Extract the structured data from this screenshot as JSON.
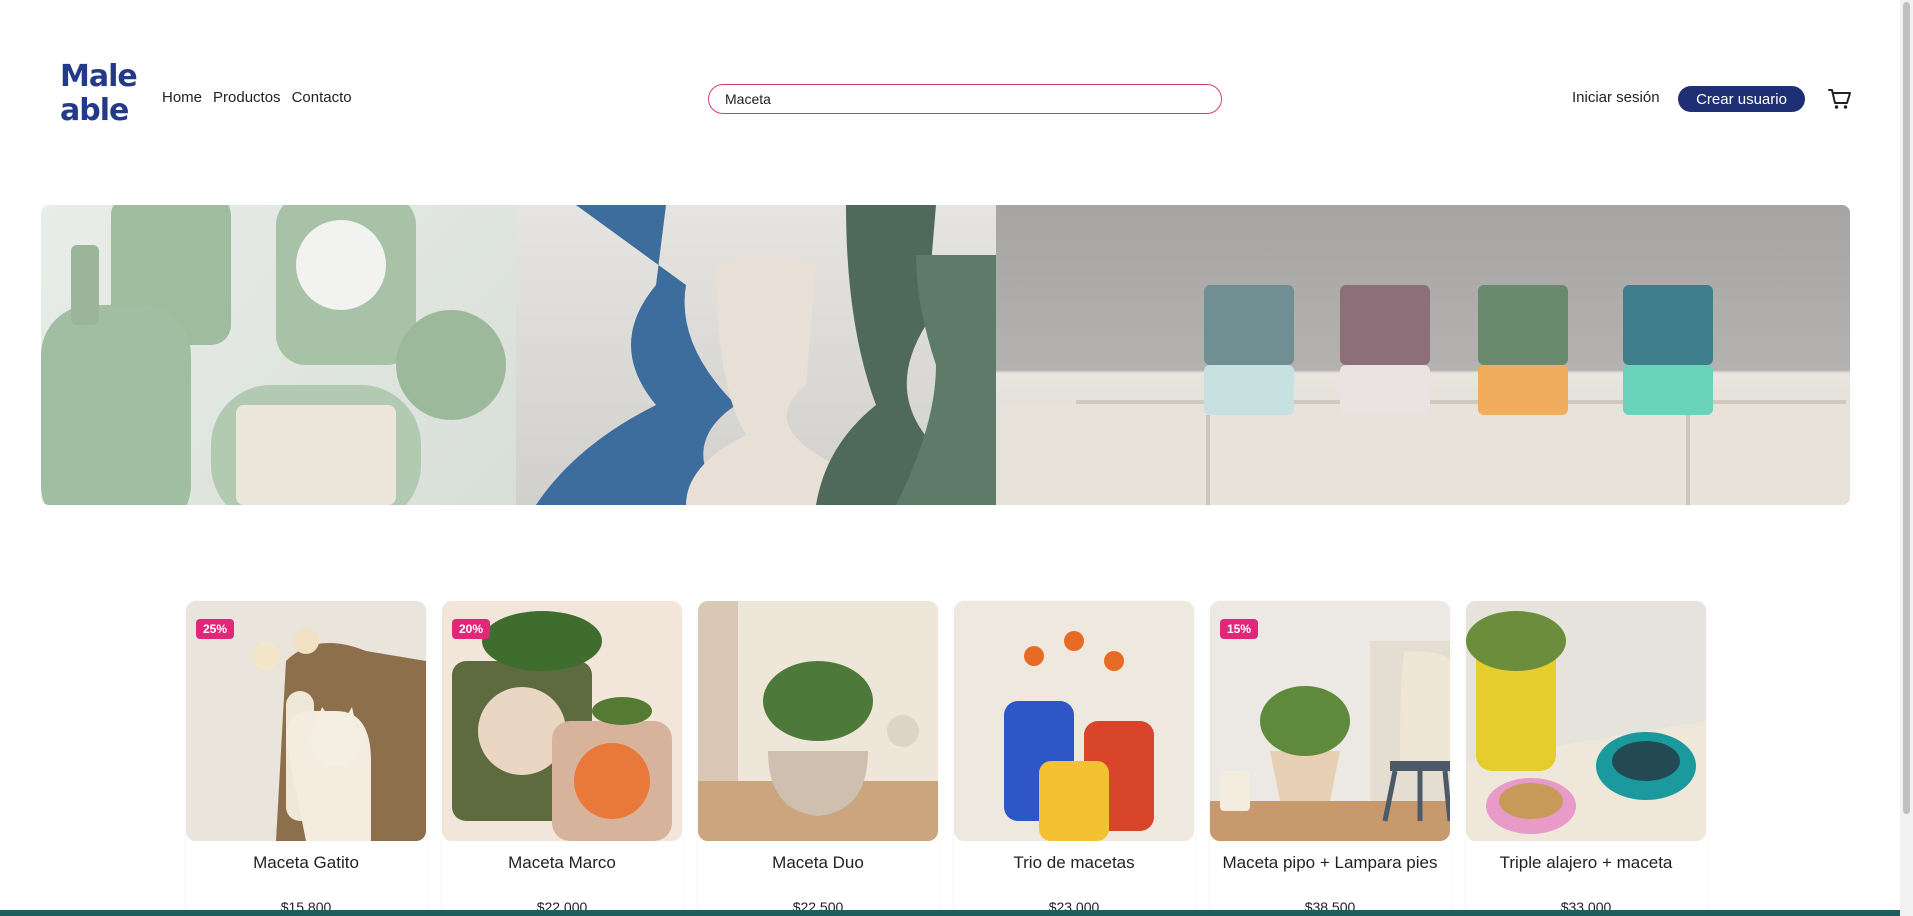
{
  "logo": {
    "line1": "Male",
    "line2": "able"
  },
  "nav": {
    "items": [
      "Home",
      "Productos",
      "Contacto"
    ]
  },
  "search": {
    "value": "Maceta"
  },
  "account": {
    "login_label": "Iniciar sesión",
    "signup_label": "Crear usuario"
  },
  "colors": {
    "brand_blue": "#1f2f74",
    "accent_pink": "#e2277b",
    "search_border": "#d63a7e"
  },
  "icons": {
    "cart": "cart-icon"
  },
  "products": [
    {
      "name": "Maceta Gatito",
      "price": "$15.800",
      "badge": "25%"
    },
    {
      "name": "Maceta Marco",
      "price": "$22.000",
      "badge": "20%"
    },
    {
      "name": "Maceta Duo",
      "price": "$22.500",
      "badge": ""
    },
    {
      "name": "Trio de macetas",
      "price": "$23.000",
      "badge": ""
    },
    {
      "name": "Maceta pipo + Lampara pies",
      "price": "$38.500",
      "badge": "15%"
    },
    {
      "name": "Triple alajero + maceta",
      "price": "$33.000",
      "badge": ""
    }
  ]
}
